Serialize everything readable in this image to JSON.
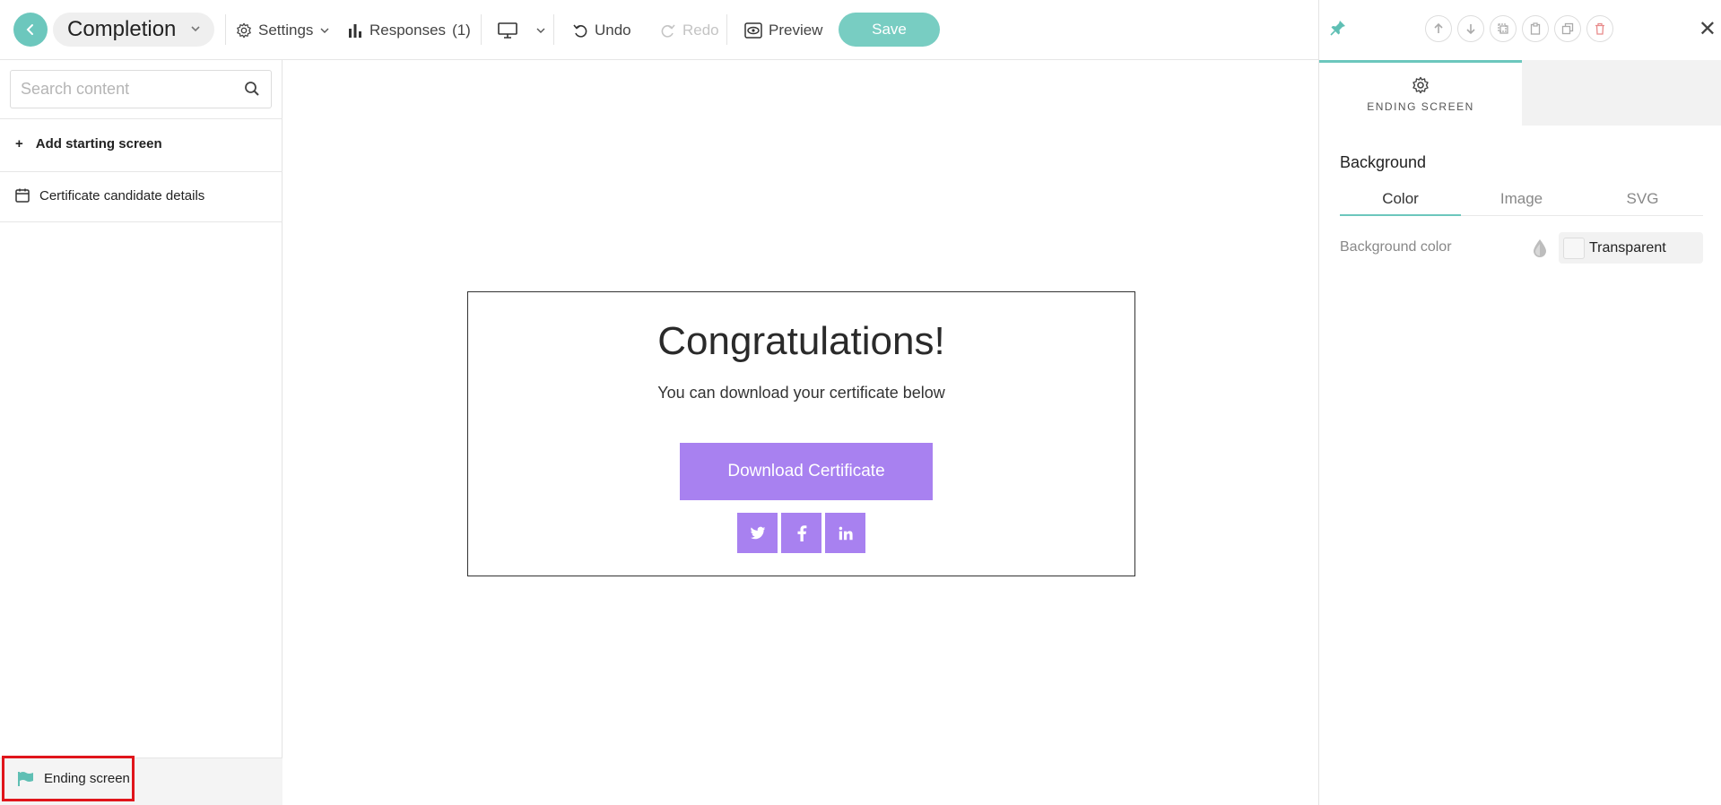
{
  "header": {
    "title": "Completion",
    "settings_label": "Settings",
    "responses_label": "Responses",
    "responses_count": "(1)",
    "undo_label": "Undo",
    "redo_label": "Redo",
    "preview_label": "Preview",
    "save_label": "Save"
  },
  "sidebar": {
    "search_placeholder": "Search content",
    "add_starting_label": "Add starting screen",
    "add_starting_icon": "+",
    "items": [
      {
        "label": "Certificate candidate details",
        "icon": "calendar-icon"
      }
    ],
    "ending_label": "Ending screen"
  },
  "canvas": {
    "heading": "Congratulations!",
    "subtext": "You can download your certificate below",
    "button_label": "Download Certificate",
    "social": [
      "twitter",
      "facebook",
      "linkedin"
    ]
  },
  "panel": {
    "tab_label": "ENDING SCREEN",
    "section_title": "Background",
    "tabs": [
      "Color",
      "Image",
      "SVG"
    ],
    "active_tab": "Color",
    "bg_color_label": "Background color",
    "bg_color_value": "Transparent"
  },
  "colors": {
    "accent": "#6cc7bd",
    "button": "#a881f0",
    "highlight": "#e0151b"
  }
}
